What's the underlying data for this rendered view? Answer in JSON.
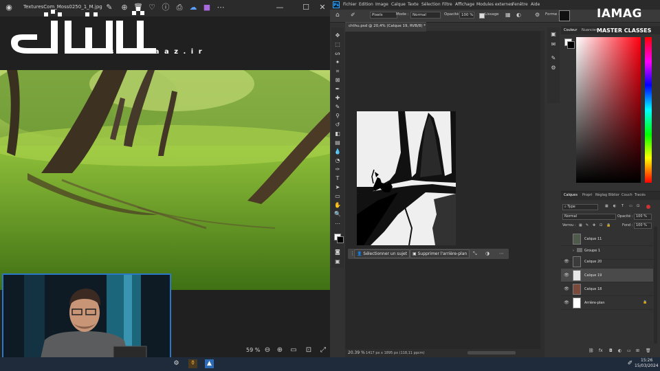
{
  "viewer": {
    "filename": "TexturesCom_Moss0250_1_M.jpg",
    "zoom": "59 %"
  },
  "watermark": {
    "url": "w w w . s o f t s a a z . i r"
  },
  "photoshop": {
    "app_icon": "Ps",
    "menu": [
      "Fichier",
      "Edition",
      "Image",
      "Calque",
      "Texte",
      "Sélection",
      "Filtre",
      "Affichage",
      "Modules externes",
      "Fenêtre",
      "Aide"
    ],
    "options": {
      "units": "Pixels",
      "mode_label": "Mode :",
      "mode_value": "Normal",
      "opacity_label": "Opacité :",
      "opacity_value": "100 %",
      "smoothing_label": "Lissage",
      "shape_label": "Forme :"
    },
    "document_tab": "chthu.psd @ 20,4% (Calque 19, RVB/8) *",
    "context_bar": {
      "select_subject": "Sélectionner un sujet",
      "remove_background": "Supprimer l'arrière-plan"
    },
    "status": {
      "zoom": "20.39 %",
      "doc_size": "1417 px x 1895 px (118,11 ppcm)"
    },
    "color_panel": {
      "tabs": [
        "Couleur",
        "Nuancier"
      ],
      "foreground": "#ffffff",
      "background": "#000000"
    },
    "layers_panel": {
      "tabs": [
        "Calques",
        "Propri",
        "Réglag",
        "Biblior",
        "Couch",
        "Tracés"
      ],
      "filter_kind": "Type",
      "blend_mode": "Normal",
      "opacity_label": "Opacité :",
      "opacity_value": "100 %",
      "lock_label": "Verrou :",
      "fill_label": "Fond :",
      "fill_value": "100 %",
      "layers": [
        {
          "name": "Calque 11",
          "visible": false,
          "thumb": "#4f5a4b"
        },
        {
          "name": "Groupe 1",
          "visible": false,
          "thumb": "folder"
        },
        {
          "name": "Calque 20",
          "visible": true,
          "thumb": "#3b3b3b"
        },
        {
          "name": "Calque 19",
          "visible": true,
          "thumb": "#e8e8e8",
          "selected": true
        },
        {
          "name": "Calque 18",
          "visible": true,
          "thumb": "#7a4a3c"
        },
        {
          "name": "Arrière-plan",
          "visible": true,
          "thumb": "#ffffff",
          "locked": true
        }
      ]
    }
  },
  "brand": {
    "title": "IAMAG",
    "subtitle": "MASTER CLASSES"
  },
  "taskbar": {
    "time": "15:26",
    "date": "15/03/2024"
  }
}
